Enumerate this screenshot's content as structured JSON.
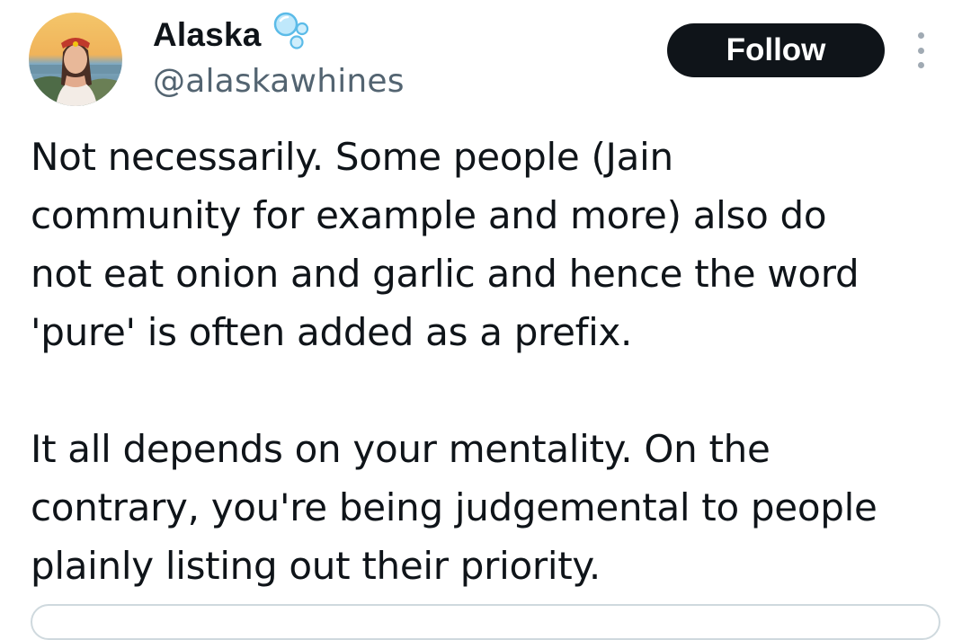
{
  "author": {
    "display_name": "Alaska",
    "handle": "@alaskawhines",
    "badge_icon": "bubbles-icon",
    "avatar_icon": "avatar-photo"
  },
  "actions": {
    "follow_label": "Follow",
    "more_icon": "more-vertical-icon"
  },
  "tweet": {
    "paragraphs": [
      "Not necessarily. Some people (Jain\ncommunity for example and more) also do\nnot eat onion and garlic and hence the word\n'pure' is often added as a prefix.",
      "It all depends on your mentality. On the\ncontrary, you're being judgemental to people\nplainly listing out their priority."
    ]
  },
  "colors": {
    "text_primary": "#0f1419",
    "text_secondary": "#536471",
    "follow_bg": "#0f1419",
    "follow_text": "#ffffff",
    "border": "#cfd9de",
    "bubble": "#6ec6f0"
  }
}
